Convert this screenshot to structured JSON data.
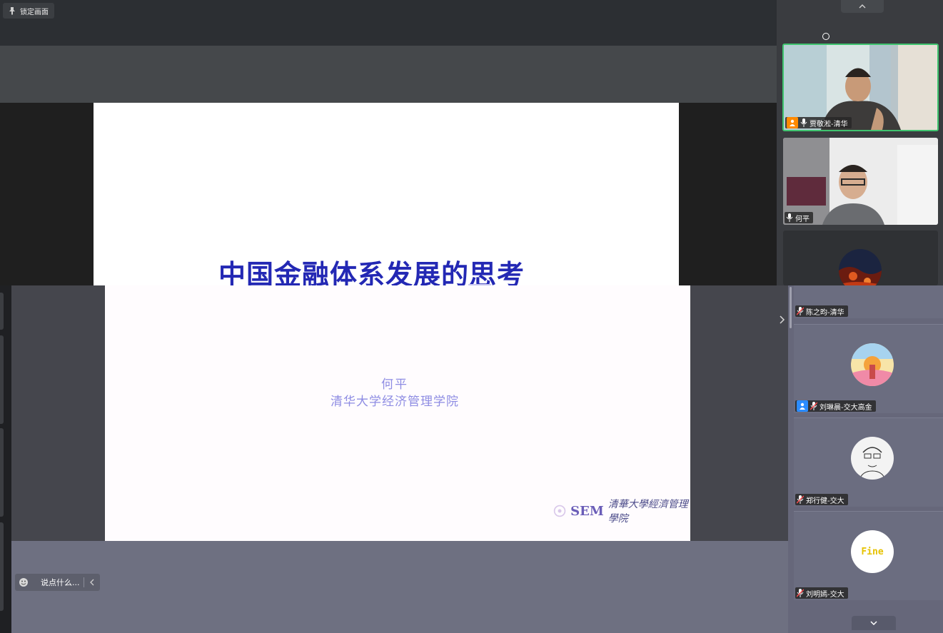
{
  "lock_button": {
    "label": "锁定画面",
    "icon": "pin-icon"
  },
  "slide": {
    "title": "中国金融体系发展的思考",
    "author": "何平",
    "org": "清华大学经济管理学院",
    "logo_abbr": "SEM",
    "logo_script": "清華大學經濟管理學院"
  },
  "participants": [
    {
      "name": "贾敬淞-清华",
      "icon": "microphone-icon",
      "role": "host",
      "video": true,
      "active_speaker": true
    },
    {
      "name": "何平",
      "icon": "microphone-icon",
      "video": true
    },
    {
      "name": "陈之昀-清华",
      "icon": "microphone-muted-icon",
      "avatar": "lava-avatar"
    },
    {
      "name": "刘琳晨-交大高金",
      "icon": "microphone-muted-icon",
      "role": "cohost",
      "avatar": "sunset-avatar"
    },
    {
      "name": "郑行健-交大",
      "icon": "microphone-muted-icon",
      "avatar": "sketch-avatar"
    },
    {
      "name": "刘明嫣-交大",
      "icon": "microphone-muted-icon",
      "avatar": "text-avatar",
      "avatar_text": "Fine"
    }
  ],
  "chat": {
    "placeholder": "说点什么..."
  }
}
